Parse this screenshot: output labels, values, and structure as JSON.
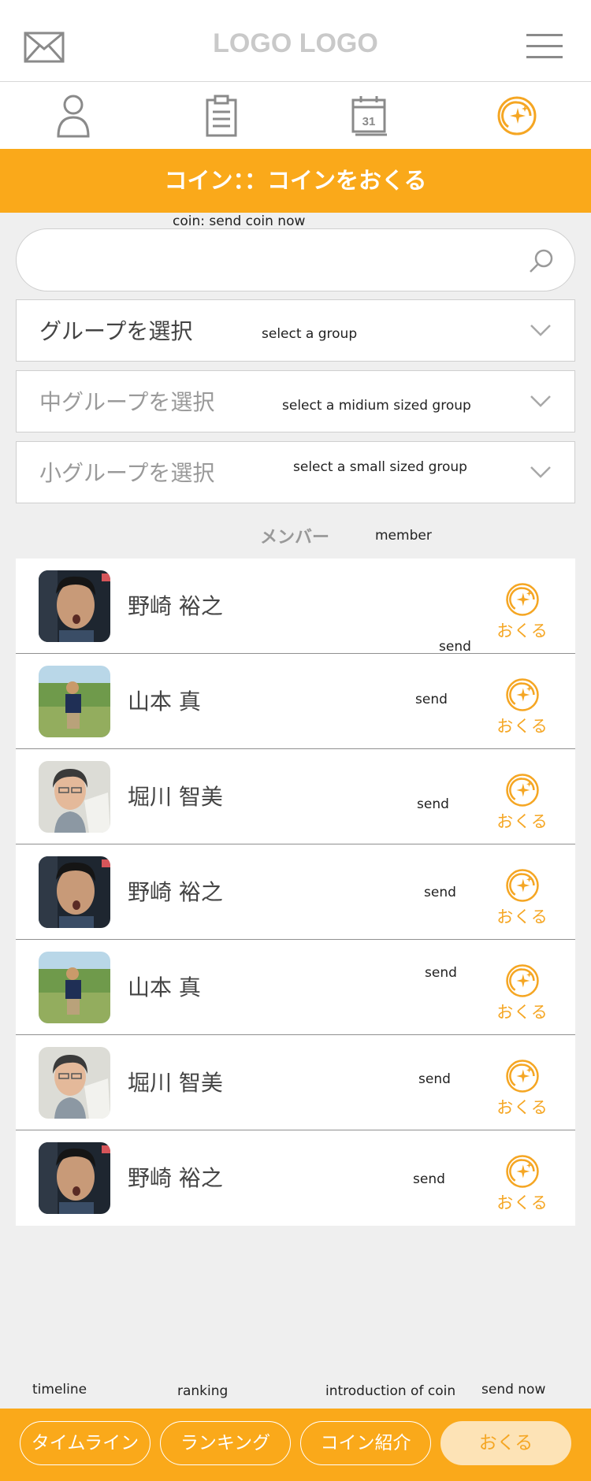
{
  "header": {
    "logo": "LOGO LOGO",
    "mail_icon": "mail-icon",
    "menu_icon": "hamburger-menu-icon"
  },
  "tabs": [
    {
      "icon": "person-icon",
      "active": false
    },
    {
      "icon": "clipboard-icon",
      "active": false
    },
    {
      "icon": "calendar-icon",
      "label": "31",
      "active": false
    },
    {
      "icon": "coin-icon",
      "active": true
    }
  ],
  "banner": {
    "title": "コイン：：コインをおくる",
    "note": "coin: send coin now"
  },
  "search": {
    "placeholder": "",
    "icon": "search-icon"
  },
  "filters": [
    {
      "label": "グループを選択",
      "note": "select a group",
      "state": "active"
    },
    {
      "label": "中グループを選択",
      "note": "select a midium sized group",
      "state": "disabled"
    },
    {
      "label": "小グループを選択",
      "note": "select a small sized group",
      "state": "disabled"
    }
  ],
  "members_section": {
    "title": "メンバー",
    "note": "member"
  },
  "members": [
    {
      "name": "野崎 裕之",
      "avatar": "photo-man-dark",
      "button": "おくる",
      "note": "send"
    },
    {
      "name": "山本 真",
      "avatar": "photo-man-field",
      "button": "おくる",
      "note": "send"
    },
    {
      "name": "堀川 智美",
      "avatar": "photo-woman",
      "button": "おくる",
      "note": "send"
    },
    {
      "name": "野崎 裕之",
      "avatar": "photo-man-dark",
      "button": "おくる",
      "note": "send"
    },
    {
      "name": "山本 真",
      "avatar": "photo-man-field",
      "button": "おくる",
      "note": "send"
    },
    {
      "name": "堀川 智美",
      "avatar": "photo-woman",
      "button": "おくる",
      "note": "send"
    },
    {
      "name": "野崎 裕之",
      "avatar": "photo-man-dark",
      "button": "おくる",
      "note": "send"
    }
  ],
  "bottom_nav": [
    {
      "label": "タイムライン",
      "note": "timeline",
      "active": false
    },
    {
      "label": "ランキング",
      "note": "ranking",
      "active": false
    },
    {
      "label": "コイン紹介",
      "note": "introduction of coin",
      "active": false
    },
    {
      "label": "おくる",
      "note": "send now",
      "active": true
    }
  ],
  "colors": {
    "accent": "#faa91a",
    "icon_orange": "#f5a623",
    "background": "#efefef",
    "muted_text": "#9a9a9a"
  }
}
